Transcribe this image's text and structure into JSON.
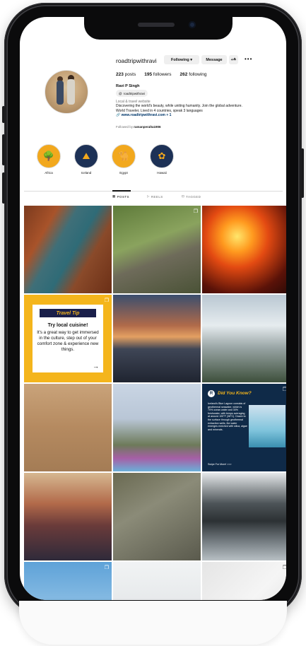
{
  "profile": {
    "username": "roadtripwithravi",
    "following_label": "Following ▾",
    "message_label": "Message",
    "add_user_glyph": "+≗",
    "more_glyph": "•••",
    "posts_count": "223",
    "posts_label": "posts",
    "followers_count": "195",
    "followers_label": "followers",
    "following_count": "262",
    "following_stat_label": "following",
    "display_name": "Ravi P Singh",
    "threads_handle": "roadtripwithravi",
    "category": "Local & travel website",
    "bio_line1": "Discovering the world's beauty, while uniting humanity. Join the global adventure.",
    "bio_line2": "World Traveler, Lived in 4 countries, speak 3 languages",
    "link_text": "www.roadtripwithravi.com + 1",
    "followed_by_prefix": "Followed by ",
    "followed_by_user": "ramanperalta1906"
  },
  "highlights": [
    {
      "label": "Africa",
      "icon": "tree-icon",
      "glyph": "🌳",
      "color": "#f2a81d"
    },
    {
      "label": "Iceland",
      "icon": "mountain-icon",
      "glyph": "⛰",
      "color": "#1d3156"
    },
    {
      "label": "Egypt",
      "icon": "camel-icon",
      "glyph": "🐪",
      "color": "#f2a81d"
    },
    {
      "label": "Hawaii",
      "icon": "hibiscus-icon",
      "glyph": "✿",
      "color": "#1d3156"
    }
  ],
  "tabs": [
    {
      "label": "POSTS",
      "icon": "grid-icon",
      "glyph": "▦"
    },
    {
      "label": "REELS",
      "icon": "reels-icon",
      "glyph": "▷"
    },
    {
      "label": "TAGGED",
      "icon": "tagged-icon",
      "glyph": "⊡"
    }
  ],
  "travel_tip": {
    "title": "Travel Tip",
    "headline": "Try local cuisine!",
    "body": "It's a great way to get immersed in the culture, step out of your comfort zone & experience new things.",
    "arrow": "→"
  },
  "did_you_know": {
    "title": "Did You Know?",
    "text": "Iceland's Blue Lagoon consists of geothermal seawater, which is 70% ocean water and 30% freshwater, with temps averaging at around 100°F (38°C). Drawn to the surface through geothermal extraction wells, the water emerges enriched with silica, algae and minerals.",
    "footer": "Swipe For More! >>>"
  },
  "colors": {
    "accent_yellow": "#f2a81d",
    "accent_navy": "#1d3156",
    "link": "#00376b"
  }
}
